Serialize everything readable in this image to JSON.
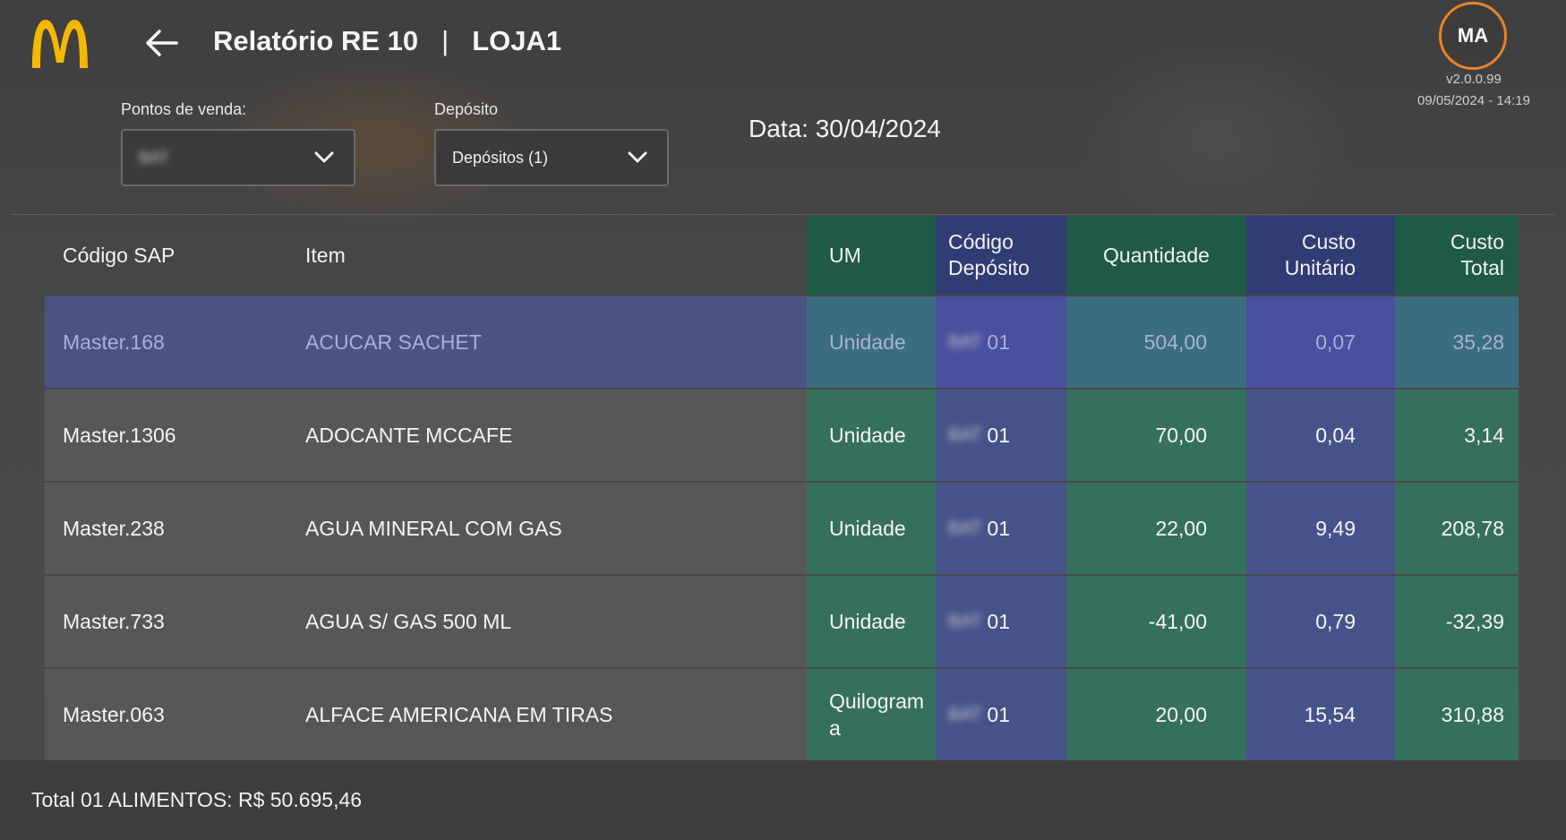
{
  "header": {
    "title": "Relatório RE 10",
    "separator": "|",
    "store": "LOJA1",
    "avatar_initials": "MA",
    "version": "v2.0.0.99",
    "timestamp": "09/05/2024 - 14:19"
  },
  "filters": {
    "pontos_label": "Pontos de venda:",
    "pontos_value": "BAT",
    "deposito_label": "Depósito",
    "deposito_value": "Depósitos (1)",
    "date_text": "Data: 30/04/2024"
  },
  "table": {
    "headers": {
      "sap": "Código SAP",
      "item": "Item",
      "um": "UM",
      "deposito_l1": "Código",
      "deposito_l2": "Depósito",
      "quantidade": "Quantidade",
      "custo_unit_l1": "Custo",
      "custo_unit_l2": "Unitário",
      "custo_total_l1": "Custo",
      "custo_total_l2": "Total"
    },
    "rows": [
      {
        "sap": "Master.168",
        "item": "ACUCAR SACHET",
        "um": "Unidade",
        "dep_prefix": "BAT",
        "dep_code": "01",
        "qty": "504,00",
        "unit": "0,07",
        "total": "35,28"
      },
      {
        "sap": "Master.1306",
        "item": "ADOCANTE MCCAFE",
        "um": "Unidade",
        "dep_prefix": "BAT",
        "dep_code": "01",
        "qty": "70,00",
        "unit": "0,04",
        "total": "3,14"
      },
      {
        "sap": "Master.238",
        "item": "AGUA MINERAL COM GAS",
        "um": "Unidade",
        "dep_prefix": "BAT",
        "dep_code": "01",
        "qty": "22,00",
        "unit": "9,49",
        "total": "208,78"
      },
      {
        "sap": "Master.733",
        "item": "AGUA S/ GAS 500 ML",
        "um": "Unidade",
        "dep_prefix": "BAT",
        "dep_code": "01",
        "qty": "-41,00",
        "unit": "0,79",
        "total": "-32,39"
      },
      {
        "sap": "Master.063",
        "item": "ALFACE AMERICANA EM TIRAS",
        "um_l1": "Quilogram",
        "um_l2": "a",
        "dep_prefix": "BAT",
        "dep_code": "01",
        "qty": "20,00",
        "unit": "15,54",
        "total": "310,88"
      }
    ]
  },
  "footer": {
    "total_text": "Total 01 ALIMENTOS: R$ 50.695,46"
  },
  "colors": {
    "logo": "#f5b800",
    "avatar_ring": "#e8832a",
    "col_green": "#35705c",
    "col_blue": "#45538a",
    "row_selected": "#4d5285"
  },
  "icons": [
    "mcdonalds-logo",
    "back-arrow-icon",
    "chevron-down-icon"
  ]
}
